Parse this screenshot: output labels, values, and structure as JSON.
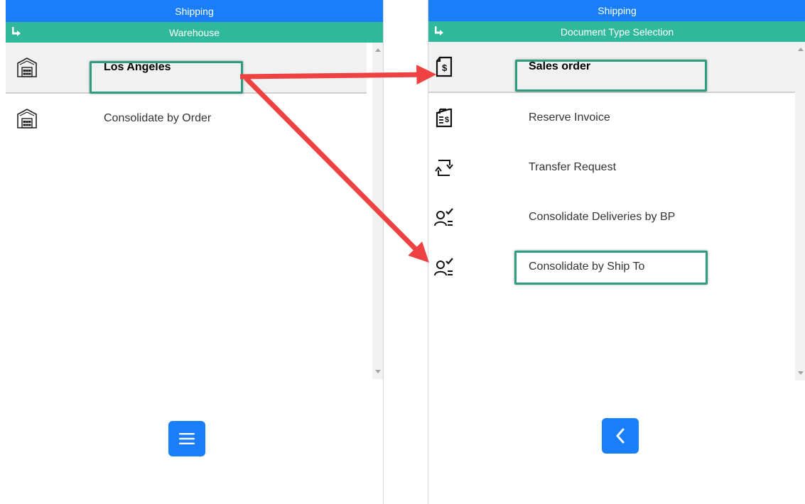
{
  "colors": {
    "header_blue": "#1a7ef8",
    "sub_header_green": "#2fb89a",
    "highlight_green": "#2e9c7e",
    "annotation_arrow": "#ee4242"
  },
  "left_panel": {
    "title": "Shipping",
    "subtitle": "Warehouse",
    "back_icon": "corner-down-right-arrow-icon",
    "items": [
      {
        "label": "Los Angeles",
        "icon": "warehouse-icon",
        "selected": true
      },
      {
        "label": "Consolidate by Order",
        "icon": "warehouse-icon",
        "selected": false
      }
    ],
    "bottom_button_icon": "menu-hamburger-icon"
  },
  "right_panel": {
    "title": "Shipping",
    "subtitle": "Document Type Selection",
    "back_icon": "corner-down-right-arrow-icon",
    "items": [
      {
        "label": "Sales order",
        "icon": "document-dollar-icon",
        "selected": true
      },
      {
        "label": "Reserve Invoice",
        "icon": "invoice-dollar-icon",
        "selected": false
      },
      {
        "label": "Transfer Request",
        "icon": "transfer-arrows-icon",
        "selected": false
      },
      {
        "label": "Consolidate Deliveries by BP",
        "icon": "user-check-icon",
        "selected": false
      },
      {
        "label": "Consolidate by Ship To",
        "icon": "user-check-icon",
        "selected": false
      }
    ],
    "bottom_button_icon": "chevron-left-icon"
  }
}
